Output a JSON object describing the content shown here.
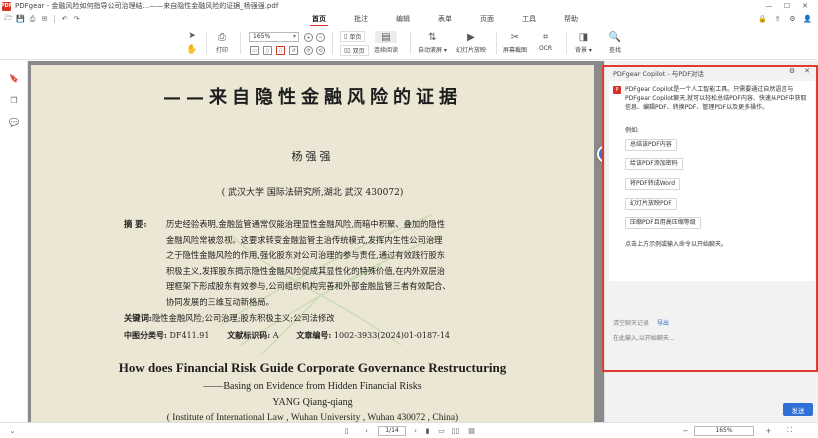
{
  "window": {
    "logo": "PDF",
    "title": "PDFgear - 金融风险如何指导公司治理结...——来自隐性金融风险的证据_杨强强.pdf",
    "controls": [
      "—",
      "☐",
      "✕"
    ]
  },
  "menu_tabs": [
    "首页",
    "批注",
    "编辑",
    "表单",
    "页面",
    "工具",
    "帮助"
  ],
  "active_tab": "首页",
  "toolbar": {
    "print_label": "打印",
    "zoom_value": "165%",
    "single_page_label": "单页",
    "double_page_label": "双页",
    "continuous_label": "连续阅读",
    "auto_scroll_label": "自动滚屏",
    "slideshow_label": "幻灯片放映",
    "screenshot_label": "屏幕截图",
    "ocr_label": "OCR",
    "background_label": "背景",
    "search_label": "查找"
  },
  "document": {
    "title": "——来自隐性金融风险的证据",
    "author": "杨强强",
    "affiliation": "( 武汉大学 国际法研究所,湖北 武汉 430072)",
    "abstract_label": "摘  要:",
    "abstract_lines": [
      "历史经验表明,金融监管通常仅能治理显性金融风险,而暗中积聚、叠加的隐性",
      "金融风险常被忽视。这要求转变金融监管主治传统模式,发挥内生性公司治理",
      "之于隐性金融风险的作用,强化股东对公司治理的参与责任,通过有效践行股东",
      "积极主义,发挥股东揭示隐性金融风险促成其显性化的特殊价值,在内外双层治",
      "理框架下形成股东有效参与,公司组织机构完善和外部金融监管三者有效配合、",
      "协同发展的三维互动新格局。"
    ],
    "keywords_label": "关键词:",
    "keywords": "隐性金融风险;公司治理;股东积极主义;公司法修改",
    "class_label": "中图分类号:",
    "class_value": "DF411.91",
    "code_label": "文献标识码:",
    "code_value": "A",
    "article_label": "文章编号:",
    "article_value": "1002-3933(2024)01-0187-14",
    "en_title": "How does Financial Risk Guide Corporate Governance Restructuring",
    "en_subtitle": "——Basing on Evidence from Hidden Financial Risks",
    "en_author": "YANG Qiang-qiang",
    "en_affiliation": "( Institute of International Law , Wuhan University , Wuhan 430072 , China)"
  },
  "copilot": {
    "header": "PDFgear Copilot - 与PDF对话",
    "intro": "PDFgear Copilot是一个人工智能工具。只需要通过自然语言与PDFgear Copilot聊天,就可以轻松总结PDF内容、快速从PDF中获取信息、编辑PDF、转换PDF、管理PDF以及更多操作。",
    "examples_label": "例如:",
    "examples": [
      "总结该PDF内容",
      "给该PDF添加密码",
      "将PDF转成Word",
      "幻灯片放映PDF",
      "压缩PDF且用高压缩等级"
    ],
    "hint": "点击上方示例或输入命令以开始聊天。",
    "clear_label": "清空聊天记录",
    "export_label": "导出",
    "input_placeholder": "在此输入,以开始聊天...",
    "send_label": "发送"
  },
  "statusbar": {
    "page_value": "1/14",
    "zoom_value": "165%"
  }
}
